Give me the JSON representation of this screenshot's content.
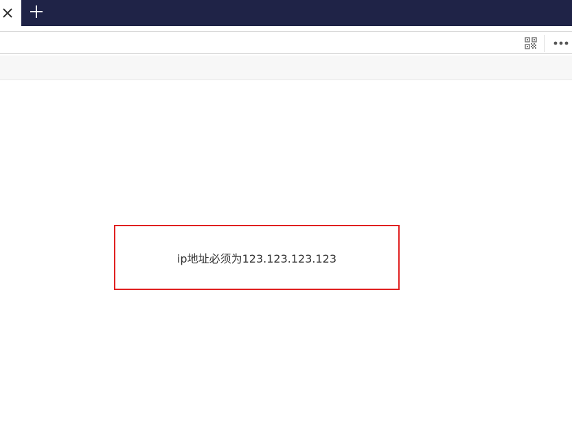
{
  "browser": {
    "tabs": {
      "close_icon": "close-icon",
      "new_tab_icon": "plus-icon"
    },
    "toolbar": {
      "qr_icon": "qr-code-icon",
      "more_icon": "more-horizontal-icon"
    },
    "colors": {
      "tab_strip": "#1f2347",
      "bookmarks_bar": "#f7f7f7"
    }
  },
  "page": {
    "alert": {
      "message": "ip地址必须为123.123.123.123",
      "border_color": "#e02020"
    }
  }
}
